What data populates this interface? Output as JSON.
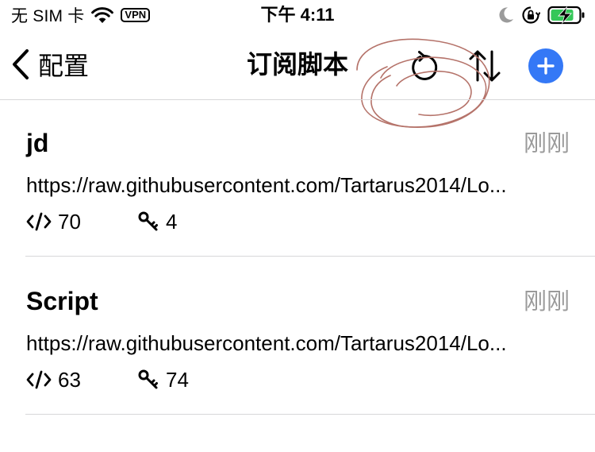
{
  "status_bar": {
    "carrier": "无 SIM 卡",
    "vpn": "VPN",
    "time": "下午 4:11"
  },
  "nav": {
    "back_label": "配置",
    "title": "订阅脚本"
  },
  "colors": {
    "accent": "#3478f6",
    "secondary_text": "#9a9a9a",
    "battery_green": "#35c759",
    "annotation": "#b5736a"
  },
  "subscriptions": [
    {
      "name": "jd",
      "updated": "刚刚",
      "url": "https://raw.githubusercontent.com/Tartarus2014/Lo...",
      "script_count": "70",
      "key_count": "4"
    },
    {
      "name": "Script",
      "updated": "刚刚",
      "url": "https://raw.githubusercontent.com/Tartarus2014/Lo...",
      "script_count": "63",
      "key_count": "74"
    }
  ]
}
